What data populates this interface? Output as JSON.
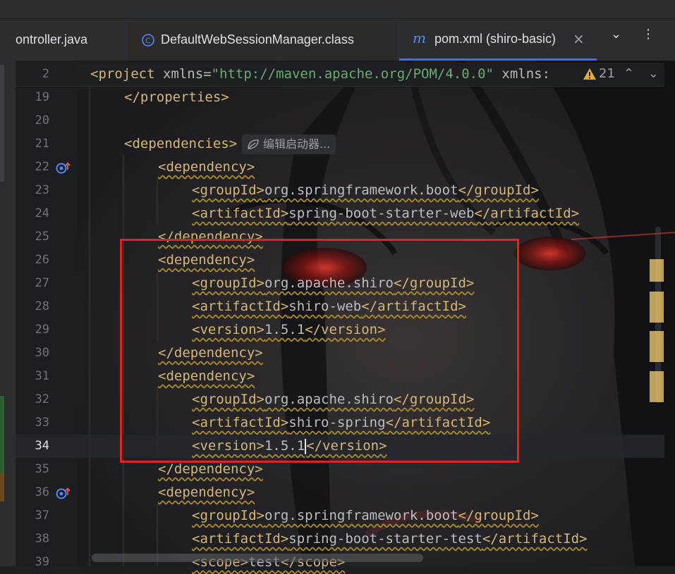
{
  "tabs": [
    {
      "label": "ontroller.java",
      "icon": "java-file-icon",
      "active": false
    },
    {
      "label": "DefaultWebSessionManager.class",
      "icon": "class-file-icon",
      "active": false
    },
    {
      "label": "pom.xml (shiro-basic)",
      "icon": "maven-file-icon",
      "active": true
    }
  ],
  "tab_close_glyph": "×",
  "problems": {
    "count": "21"
  },
  "inlay_hint": "编辑启动器...",
  "colors": {
    "tag": "#d5b778",
    "string": "#6aab73",
    "accent": "#3574f0",
    "highlight_box": "#e02424",
    "warning": "#e9aa3c"
  },
  "sticky_line": {
    "number": "2",
    "parts": [
      {
        "t": "<project",
        "c": "tg"
      },
      {
        "t": " xmlns=",
        "c": "at"
      },
      {
        "t": "\"http://maven.apache.org/POM/4.0.0\"",
        "c": "str"
      },
      {
        "t": " xmlns:",
        "c": "at"
      }
    ]
  },
  "lines": [
    {
      "number": "19",
      "indent": 4,
      "parts": [
        {
          "t": "</properties>",
          "c": "tg"
        }
      ]
    },
    {
      "number": "20",
      "indent": 0,
      "parts": []
    },
    {
      "number": "21",
      "indent": 4,
      "parts": [
        {
          "t": "<dependencies>",
          "c": "tg"
        }
      ]
    },
    {
      "number": "22",
      "indent": 8,
      "gutter_icon": "override-up-icon",
      "parts": [
        {
          "t": "<dependency>",
          "c": "tg w"
        }
      ]
    },
    {
      "number": "23",
      "indent": 12,
      "parts": [
        {
          "t": "<groupId>",
          "c": "tg w"
        },
        {
          "t": "org.springframework.boot",
          "c": "tx w"
        },
        {
          "t": "</groupId>",
          "c": "tg w"
        }
      ]
    },
    {
      "number": "24",
      "indent": 12,
      "parts": [
        {
          "t": "<artifactId>",
          "c": "tg w"
        },
        {
          "t": "spring-boot-starter-web",
          "c": "tx w"
        },
        {
          "t": "</artifactId>",
          "c": "tg w"
        }
      ]
    },
    {
      "number": "25",
      "indent": 8,
      "parts": [
        {
          "t": "</dependency>",
          "c": "tg w"
        }
      ]
    },
    {
      "number": "26",
      "indent": 8,
      "parts": [
        {
          "t": "<dependency>",
          "c": "tg w"
        }
      ]
    },
    {
      "number": "27",
      "indent": 12,
      "parts": [
        {
          "t": "<groupId>",
          "c": "tg w"
        },
        {
          "t": "org.apache.shiro",
          "c": "tx w"
        },
        {
          "t": "</groupId>",
          "c": "tg w"
        }
      ]
    },
    {
      "number": "28",
      "indent": 12,
      "parts": [
        {
          "t": "<artifactId>",
          "c": "tg w"
        },
        {
          "t": "shiro-web",
          "c": "tx w"
        },
        {
          "t": "</artifactId>",
          "c": "tg w"
        }
      ]
    },
    {
      "number": "29",
      "indent": 12,
      "parts": [
        {
          "t": "<version>",
          "c": "tg w"
        },
        {
          "t": "1.5.1",
          "c": "tx w"
        },
        {
          "t": "</version>",
          "c": "tg w"
        }
      ]
    },
    {
      "number": "30",
      "indent": 8,
      "parts": [
        {
          "t": "</dependency>",
          "c": "tg w"
        }
      ]
    },
    {
      "number": "31",
      "indent": 8,
      "parts": [
        {
          "t": "<dependency>",
          "c": "tg w"
        }
      ]
    },
    {
      "number": "32",
      "indent": 12,
      "parts": [
        {
          "t": "<groupId>",
          "c": "tg w"
        },
        {
          "t": "org.apache.shiro",
          "c": "tx w"
        },
        {
          "t": "</groupId>",
          "c": "tg w"
        }
      ]
    },
    {
      "number": "33",
      "indent": 12,
      "parts": [
        {
          "t": "<artifactId>",
          "c": "tg w"
        },
        {
          "t": "shiro-spring",
          "c": "tx w"
        },
        {
          "t": "</artifactId>",
          "c": "tg w"
        }
      ]
    },
    {
      "number": "34",
      "indent": 12,
      "current": true,
      "caret_after": 1,
      "parts": [
        {
          "t": "<version>",
          "c": "tg w"
        },
        {
          "t": "1.5.1",
          "c": "tx w"
        },
        {
          "t": "</version>",
          "c": "tg w"
        }
      ]
    },
    {
      "number": "35",
      "indent": 8,
      "parts": [
        {
          "t": "</dependency>",
          "c": "tg w"
        }
      ]
    },
    {
      "number": "36",
      "indent": 8,
      "gutter_icon": "override-up-icon",
      "parts": [
        {
          "t": "<dependency>",
          "c": "tg w"
        }
      ]
    },
    {
      "number": "37",
      "indent": 12,
      "parts": [
        {
          "t": "<groupId>",
          "c": "tg w"
        },
        {
          "t": "org.springframework.boot",
          "c": "tx w"
        },
        {
          "t": "</groupId>",
          "c": "tg w"
        }
      ]
    },
    {
      "number": "38",
      "indent": 12,
      "parts": [
        {
          "t": "<artifactId>",
          "c": "tg w"
        },
        {
          "t": "spring-boot-starter-test",
          "c": "tx w"
        },
        {
          "t": "</artifactId>",
          "c": "tg w"
        }
      ]
    },
    {
      "number": "39",
      "indent": 12,
      "parts": [
        {
          "t": "<scope>",
          "c": "tg w"
        },
        {
          "t": "test",
          "c": "tx w"
        },
        {
          "t": "</scope>",
          "c": "tg w"
        }
      ]
    }
  ]
}
